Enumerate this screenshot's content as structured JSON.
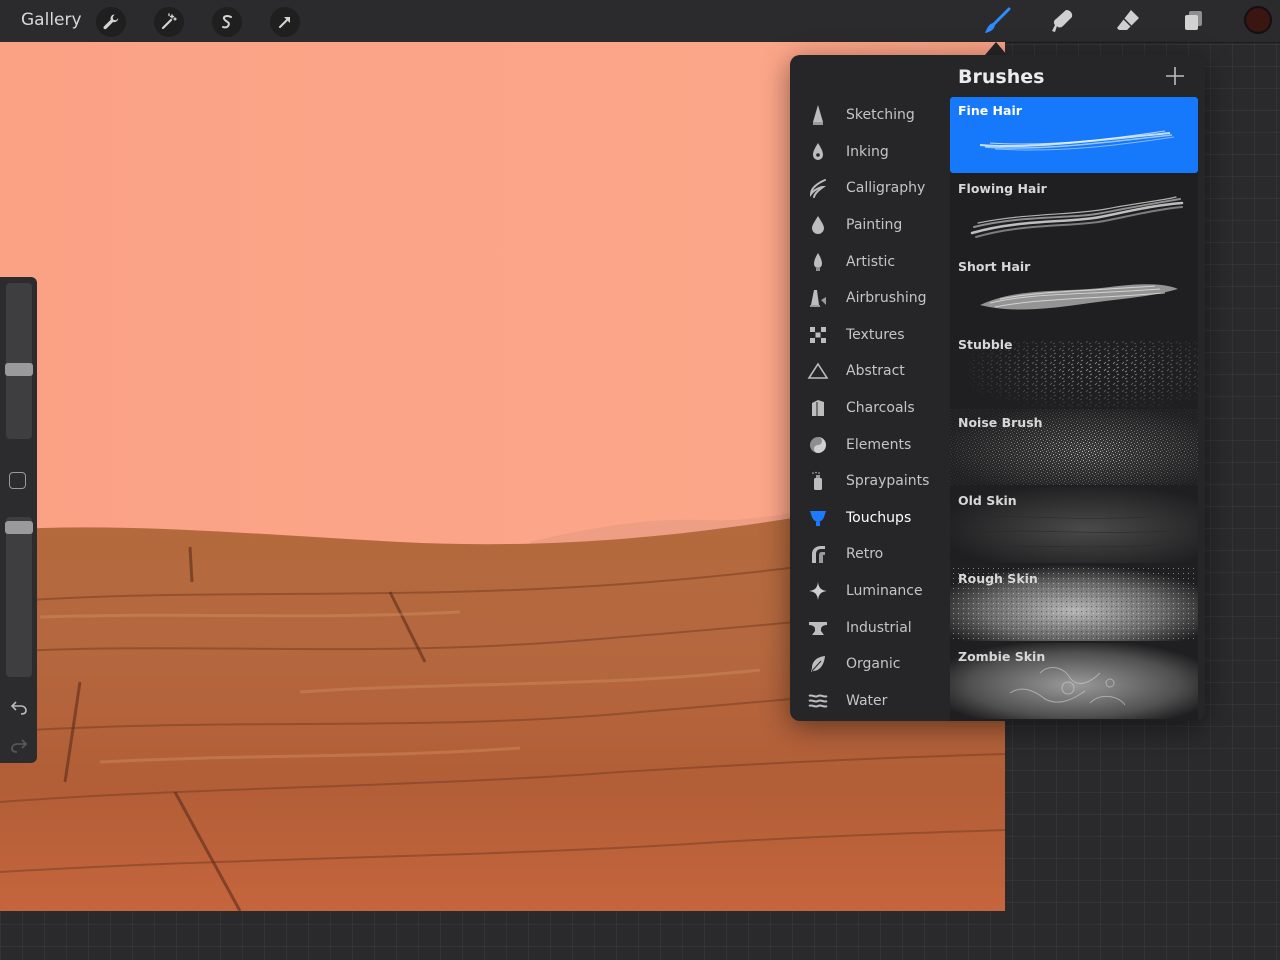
{
  "toolbar": {
    "gallery_label": "Gallery",
    "left_tools": [
      {
        "icon": "wrench-icon"
      },
      {
        "icon": "magic-wand-icon"
      },
      {
        "icon": "selection-s-icon"
      },
      {
        "icon": "transform-arrow-icon"
      }
    ],
    "right_tools": [
      {
        "icon": "brush-icon",
        "active": true
      },
      {
        "icon": "smudge-icon"
      },
      {
        "icon": "eraser-icon"
      },
      {
        "icon": "layers-icon"
      }
    ],
    "current_color": "#3a1512",
    "accent_color": "#1678fa"
  },
  "brushes_panel": {
    "title": "Brushes",
    "libraries": [
      {
        "label": "Sketching",
        "icon": "pencil-tip-icon"
      },
      {
        "label": "Inking",
        "icon": "ink-drop-icon"
      },
      {
        "label": "Calligraphy",
        "icon": "calligraphy-stroke-icon"
      },
      {
        "label": "Painting",
        "icon": "paint-drop-icon"
      },
      {
        "label": "Artistic",
        "icon": "artistic-brush-icon"
      },
      {
        "label": "Airbrushing",
        "icon": "airbrush-icon"
      },
      {
        "label": "Textures",
        "icon": "checker-texture-icon"
      },
      {
        "label": "Abstract",
        "icon": "triangle-icon"
      },
      {
        "label": "Charcoals",
        "icon": "charcoal-icon"
      },
      {
        "label": "Elements",
        "icon": "yin-yang-icon"
      },
      {
        "label": "Spraypaints",
        "icon": "spray-can-icon"
      },
      {
        "label": "Touchups",
        "icon": "touchup-brush-icon",
        "active": true
      },
      {
        "label": "Retro",
        "icon": "retro-curve-icon"
      },
      {
        "label": "Luminance",
        "icon": "sparkle-icon"
      },
      {
        "label": "Industrial",
        "icon": "anvil-icon"
      },
      {
        "label": "Organic",
        "icon": "leaf-icon"
      },
      {
        "label": "Water",
        "icon": "waves-icon"
      }
    ],
    "brushes": [
      {
        "name": "Fine Hair",
        "selected": true
      },
      {
        "name": "Flowing Hair"
      },
      {
        "name": "Short Hair"
      },
      {
        "name": "Stubble"
      },
      {
        "name": "Noise Brush"
      },
      {
        "name": "Old Skin"
      },
      {
        "name": "Rough Skin"
      },
      {
        "name": "Zombie Skin"
      }
    ]
  }
}
